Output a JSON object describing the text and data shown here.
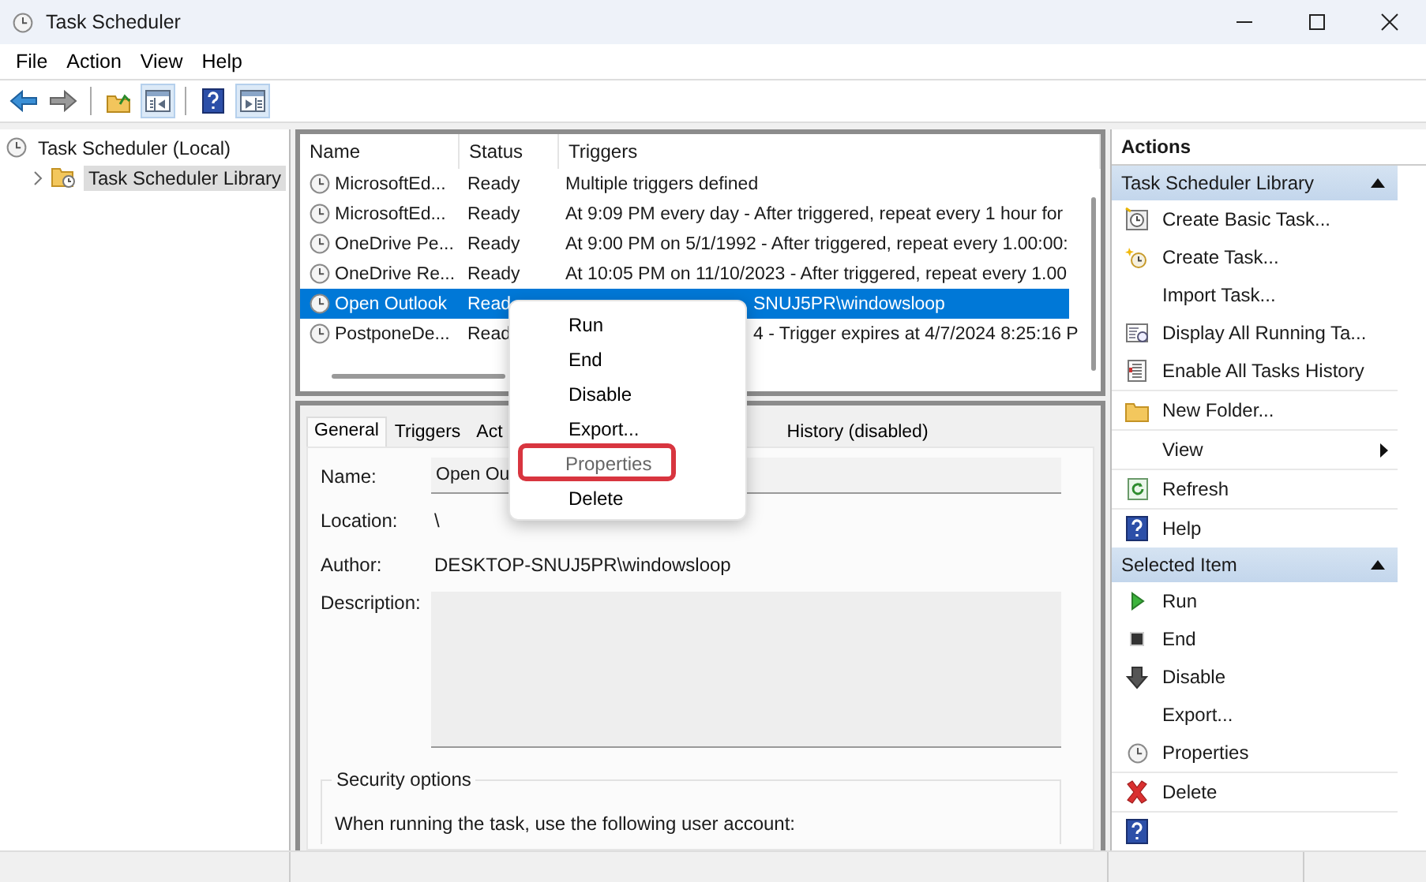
{
  "window": {
    "title": "Task Scheduler"
  },
  "menu_bar": [
    "File",
    "Action",
    "View",
    "Help"
  ],
  "toolbar": [
    {
      "kind": "back",
      "pressed": false
    },
    {
      "kind": "forward",
      "pressed": false
    },
    {
      "kind": "separator"
    },
    {
      "kind": "up-folder",
      "pressed": false
    },
    {
      "kind": "console-tree",
      "pressed": true
    },
    {
      "kind": "separator"
    },
    {
      "kind": "help",
      "pressed": false
    },
    {
      "kind": "action-pane",
      "pressed": true
    }
  ],
  "tree": [
    {
      "label": "Task Scheduler (Local)",
      "selected": false,
      "children": [
        {
          "label": "Task Scheduler Library",
          "selected": true,
          "expanded": false
        }
      ]
    }
  ],
  "task_table": {
    "columns": [
      "Name",
      "Status",
      "Triggers"
    ],
    "rows": [
      {
        "name": "MicrosoftEd...",
        "status": "Ready",
        "trigger": "Multiple triggers defined",
        "selected": false
      },
      {
        "name": "MicrosoftEd...",
        "status": "Ready",
        "trigger": "At 9:09 PM every day - After triggered, repeat every 1 hour for",
        "selected": false
      },
      {
        "name": "OneDrive Pe...",
        "status": "Ready",
        "trigger": "At 9:00 PM on 5/1/1992 - After triggered, repeat every 1.00:00:",
        "selected": false
      },
      {
        "name": "OneDrive Re...",
        "status": "Ready",
        "trigger": "At 10:05 PM on 11/10/2023 - After triggered, repeat every 1.00",
        "selected": false
      },
      {
        "name": "Open Outlook",
        "status": "Read",
        "trigger_tail": "SNUJ5PR\\windowsloop",
        "selected": true
      },
      {
        "name": "PostponeDe...",
        "status": "Read",
        "trigger_tail": "4 - Trigger expires at 4/7/2024 8:25:16 P",
        "selected": false
      }
    ]
  },
  "context_menu": [
    {
      "label": "Run",
      "annotated": false
    },
    {
      "label": "End",
      "annotated": false
    },
    {
      "label": "Disable",
      "annotated": false
    },
    {
      "label": "Export...",
      "annotated": false
    },
    {
      "label": "Properties",
      "annotated": true
    },
    {
      "label": "Delete",
      "annotated": false
    }
  ],
  "detail_tabs": [
    {
      "label": "General",
      "selected": true
    },
    {
      "label": "Triggers",
      "selected": false
    },
    {
      "label": "Act",
      "selected": false
    }
  ],
  "detail_tabs_after_menu": [
    {
      "label": "History (disabled)",
      "selected": false
    }
  ],
  "general": {
    "name_label": "Name:",
    "name_value": "Open Ou",
    "location_label": "Location:",
    "location_value": "\\",
    "author_label": "Author:",
    "author_value": "DESKTOP-SNUJ5PR\\windowsloop",
    "description_label": "Description:",
    "security_title": "Security options",
    "security_text": "When running the task, use the following user account:"
  },
  "actions_pane": {
    "title": "Actions",
    "sections": [
      {
        "title": "Task Scheduler Library",
        "expanded": true,
        "items": [
          {
            "kind": "basic-task",
            "label": "Create Basic Task...",
            "divider_after": false
          },
          {
            "kind": "create-task",
            "label": "Create Task...",
            "divider_after": false
          },
          {
            "kind": "none",
            "label": "Import Task...",
            "divider_after": false
          },
          {
            "kind": "running",
            "label": "Display All Running Ta...",
            "divider_after": false
          },
          {
            "kind": "history",
            "label": "Enable All Tasks History",
            "divider_after": true
          },
          {
            "kind": "folder",
            "label": "New Folder...",
            "divider_after": true
          },
          {
            "kind": "submenu",
            "label": "View",
            "divider_after": true
          },
          {
            "kind": "refresh",
            "label": "Refresh",
            "divider_after": true
          },
          {
            "kind": "help",
            "label": "Help",
            "divider_after": false
          }
        ]
      },
      {
        "title": "Selected Item",
        "expanded": true,
        "items": [
          {
            "kind": "run",
            "label": "Run",
            "divider_after": false
          },
          {
            "kind": "end",
            "label": "End",
            "divider_after": false
          },
          {
            "kind": "disable",
            "label": "Disable",
            "divider_after": false
          },
          {
            "kind": "none",
            "label": "Export...",
            "divider_after": false
          },
          {
            "kind": "properties",
            "label": "Properties",
            "divider_after": true
          },
          {
            "kind": "delete",
            "label": "Delete",
            "divider_after": true
          },
          {
            "kind": "help",
            "divider_after": false
          }
        ]
      }
    ]
  }
}
